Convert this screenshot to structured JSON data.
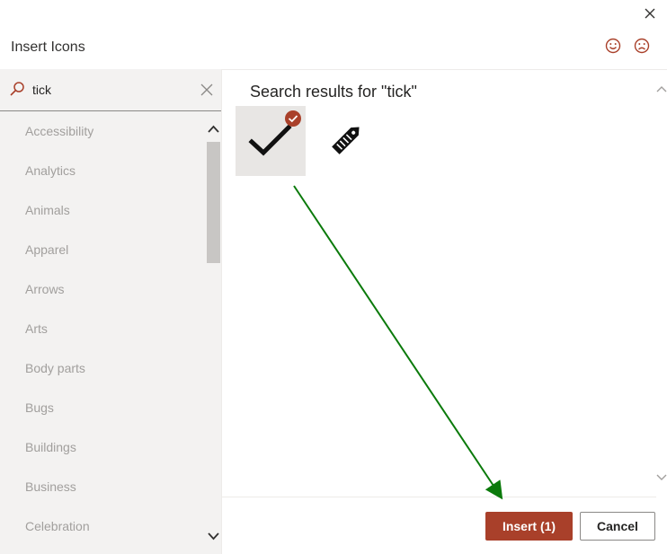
{
  "dialog": {
    "title": "Insert Icons"
  },
  "search": {
    "value": "tick"
  },
  "categories": [
    "Accessibility",
    "Analytics",
    "Animals",
    "Apparel",
    "Arrows",
    "Arts",
    "Body parts",
    "Bugs",
    "Buildings",
    "Business",
    "Celebration"
  ],
  "results": {
    "title": "Search results for \"tick\"",
    "items": [
      {
        "icon": "checkmark-icon",
        "selected": true
      },
      {
        "icon": "price-tag-icon",
        "selected": false
      }
    ]
  },
  "footer": {
    "insert_label": "Insert (1)",
    "cancel_label": "Cancel"
  },
  "colors": {
    "accent": "#a9402a",
    "arrow": "#0b7a0b",
    "panel": "#f3f2f1"
  }
}
